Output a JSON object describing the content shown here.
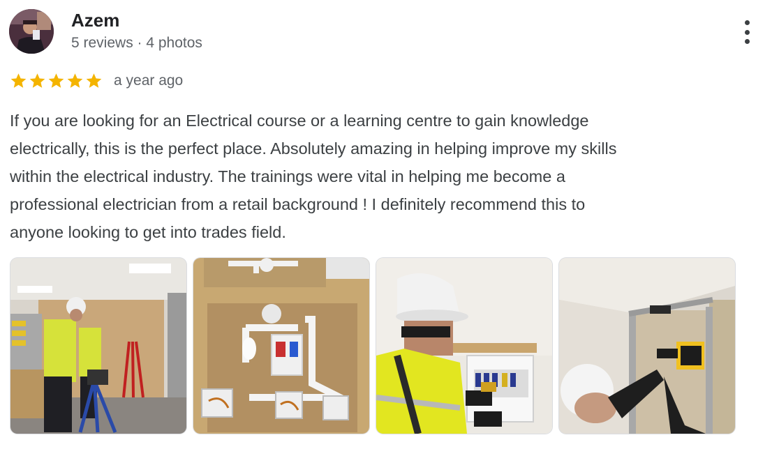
{
  "reviewer": {
    "name": "Azem",
    "meta": "5 reviews · 4 photos",
    "avatar_icon": "user-avatar-photo"
  },
  "more_options_icon": "more-vertical-icon",
  "review": {
    "rating": 5,
    "rating_max": 5,
    "star_color": "#f4b400",
    "time_ago": "a year ago",
    "text": "If you are looking for an Electrical course or a learning centre to gain knowledge\nelectrically, this is the perfect place. Absolutely amazing in helping improve my skills\nwithin the electrical industry. The trainings were vital in helping me become a\nprofessional electrician from a retail background ! I definitely recommend this to\nanyone looking to get into trades field."
  },
  "photos": [
    {
      "subject": "training-workshop-photo"
    },
    {
      "subject": "wiring-board-photo"
    },
    {
      "subject": "consumer-unit-testing-photo"
    },
    {
      "subject": "drilling-wall-photo"
    }
  ]
}
